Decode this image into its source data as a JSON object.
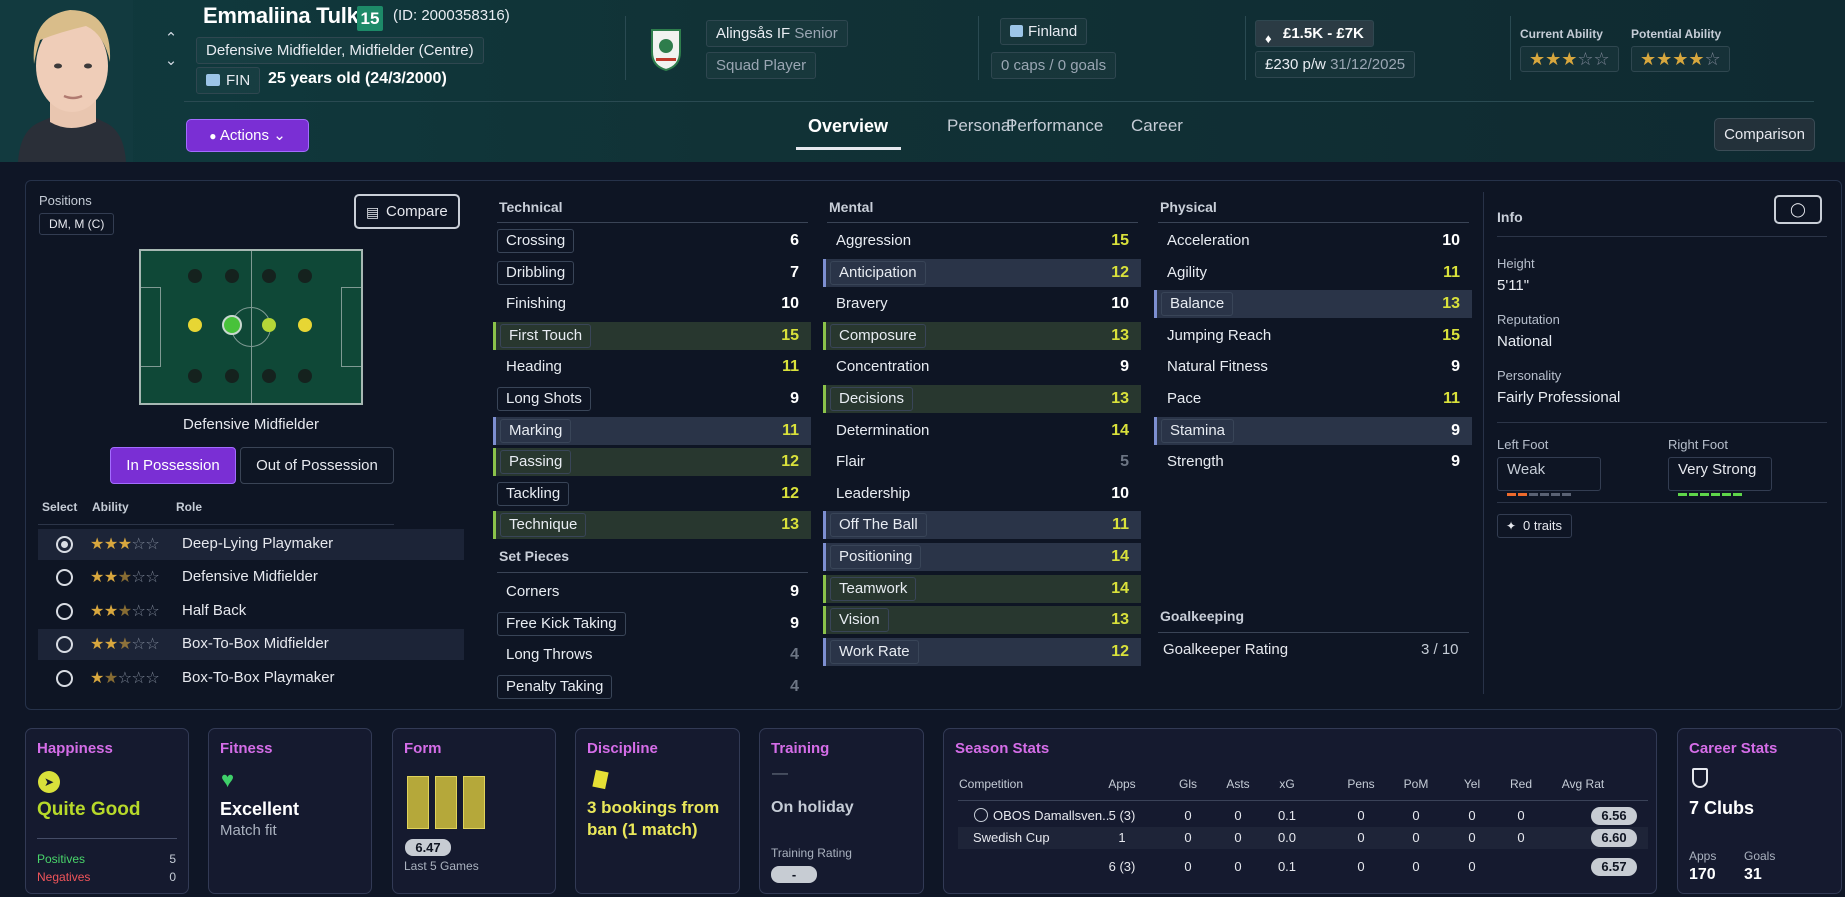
{
  "player": {
    "name": "Emmaliina Tulkki",
    "current_ability_badge": "15",
    "id_text": "(ID: 2000358316)",
    "positions_long": "Defensive Midfielder, Midfielder (Centre)",
    "nationality_code": "FIN",
    "age_text": "25 years old (24/3/2000)"
  },
  "club": {
    "name": "Alingsås IF",
    "squad": "Senior",
    "status": "Squad Player"
  },
  "nation": {
    "name": "Finland",
    "caps_goals": "0 caps / 0 goals"
  },
  "value": {
    "range": "£1.5K - £7K",
    "wage": "£230 p/w",
    "contract_end": "31/12/2025"
  },
  "ability": {
    "current_label": "Current Ability",
    "potential_label": "Potential Ability",
    "current_stars": 3,
    "potential_stars": 3.5
  },
  "nav": {
    "actions": "Actions",
    "tabs": [
      "Overview",
      "Personal",
      "Performance",
      "Career"
    ],
    "comparison": "Comparison"
  },
  "positions_panel": {
    "title": "Positions",
    "code": "DM, M (C)",
    "compare": "Compare",
    "position_name": "Defensive Midfielder",
    "in_possession": "In Possession",
    "out_of_possession": "Out of Possession",
    "col_select": "Select",
    "col_ability": "Ability",
    "col_role": "Role",
    "roles": [
      {
        "name": "Deep-Lying Playmaker",
        "stars": 3,
        "selected": true
      },
      {
        "name": "Defensive Midfielder",
        "stars": 2.5,
        "selected": false
      },
      {
        "name": "Half Back",
        "stars": 2.5,
        "selected": false
      },
      {
        "name": "Box-To-Box Midfielder",
        "stars": 2.5,
        "selected": false
      },
      {
        "name": "Box-To-Box Playmaker",
        "stars": 1.5,
        "selected": false
      }
    ]
  },
  "attributes": {
    "technical_title": "Technical",
    "technical": [
      {
        "name": "Crossing",
        "value": "6"
      },
      {
        "name": "Dribbling",
        "value": "7"
      },
      {
        "name": "Finishing",
        "value": "10"
      },
      {
        "name": "First Touch",
        "value": "15"
      },
      {
        "name": "Heading",
        "value": "11"
      },
      {
        "name": "Long Shots",
        "value": "9"
      },
      {
        "name": "Marking",
        "value": "11"
      },
      {
        "name": "Passing",
        "value": "12"
      },
      {
        "name": "Tackling",
        "value": "12"
      },
      {
        "name": "Technique",
        "value": "13"
      }
    ],
    "set_pieces_title": "Set Pieces",
    "set_pieces": [
      {
        "name": "Corners",
        "value": "9"
      },
      {
        "name": "Free Kick Taking",
        "value": "9"
      },
      {
        "name": "Long Throws",
        "value": "4"
      },
      {
        "name": "Penalty Taking",
        "value": "4"
      }
    ],
    "mental_title": "Mental",
    "mental": [
      {
        "name": "Aggression",
        "value": "15"
      },
      {
        "name": "Anticipation",
        "value": "12"
      },
      {
        "name": "Bravery",
        "value": "10"
      },
      {
        "name": "Composure",
        "value": "13"
      },
      {
        "name": "Concentration",
        "value": "9"
      },
      {
        "name": "Decisions",
        "value": "13"
      },
      {
        "name": "Determination",
        "value": "14"
      },
      {
        "name": "Flair",
        "value": "5"
      },
      {
        "name": "Leadership",
        "value": "10"
      },
      {
        "name": "Off The Ball",
        "value": "11"
      },
      {
        "name": "Positioning",
        "value": "14"
      },
      {
        "name": "Teamwork",
        "value": "14"
      },
      {
        "name": "Vision",
        "value": "13"
      },
      {
        "name": "Work Rate",
        "value": "12"
      }
    ],
    "physical_title": "Physical",
    "physical": [
      {
        "name": "Acceleration",
        "value": "10"
      },
      {
        "name": "Agility",
        "value": "11"
      },
      {
        "name": "Balance",
        "value": "13"
      },
      {
        "name": "Jumping Reach",
        "value": "15"
      },
      {
        "name": "Natural Fitness",
        "value": "9"
      },
      {
        "name": "Pace",
        "value": "11"
      },
      {
        "name": "Stamina",
        "value": "9"
      },
      {
        "name": "Strength",
        "value": "9"
      }
    ],
    "goalkeeping_title": "Goalkeeping",
    "gk_rating_label": "Goalkeeper Rating",
    "gk_rating_value": "3 / 10"
  },
  "info": {
    "title": "Info",
    "height_label": "Height",
    "height": "5'11\"",
    "reputation_label": "Reputation",
    "reputation": "National",
    "personality_label": "Personality",
    "personality": "Fairly Professional",
    "left_foot_label": "Left Foot",
    "left_foot": "Weak",
    "right_foot_label": "Right Foot",
    "right_foot": "Very Strong",
    "traits": "0 traits"
  },
  "cards": {
    "happiness": {
      "title": "Happiness",
      "value": "Quite Good",
      "positives_label": "Positives",
      "positives": "5",
      "negatives_label": "Negatives",
      "negatives": "0"
    },
    "fitness": {
      "title": "Fitness",
      "value": "Excellent",
      "sub": "Match fit"
    },
    "form": {
      "title": "Form",
      "rating": "6.47",
      "sub": "Last 5 Games"
    },
    "discipline": {
      "title": "Discipline",
      "value": "3 bookings from ban (1 match)"
    },
    "training": {
      "title": "Training",
      "dash": "—",
      "value": "On holiday",
      "rating_label": "Training Rating",
      "rating": "-"
    },
    "season": {
      "title": "Season Stats",
      "headers": [
        "Competition",
        "Apps",
        "Gls",
        "Asts",
        "xG",
        "Pens",
        "PoM",
        "Yel",
        "Red",
        "Avg Rat"
      ],
      "rows": [
        [
          "OBOS Damallsven...",
          "5 (3)",
          "0",
          "0",
          "0.1",
          "0",
          "0",
          "0",
          "0",
          "6.56"
        ],
        [
          "Swedish Cup",
          "1",
          "0",
          "0",
          "0.0",
          "0",
          "0",
          "0",
          "0",
          "6.60"
        ],
        [
          "",
          "6 (3)",
          "0",
          "0",
          "0.1",
          "0",
          "0",
          "0",
          "",
          "6.57"
        ]
      ]
    },
    "career": {
      "title": "Career Stats",
      "clubs": "7 Clubs",
      "apps_label": "Apps",
      "apps": "170",
      "goals_label": "Goals",
      "goals": "31"
    }
  }
}
